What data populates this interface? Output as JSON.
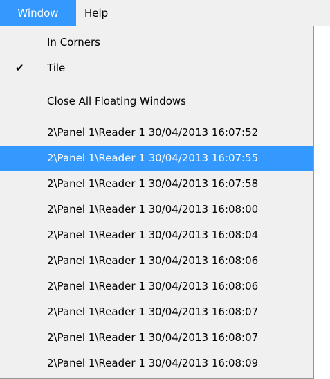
{
  "menubar": {
    "window_label": "Window",
    "help_label": "Help"
  },
  "menu": {
    "in_corners": "In Corners",
    "tile": "Tile",
    "tile_checked": "✔",
    "close_all": "Close All Floating Windows",
    "windows": [
      "2\\Panel 1\\Reader 1 30/04/2013 16:07:52",
      "2\\Panel 1\\Reader 1 30/04/2013 16:07:55",
      "2\\Panel 1\\Reader 1 30/04/2013 16:07:58",
      "2\\Panel 1\\Reader 1 30/04/2013 16:08:00",
      "2\\Panel 1\\Reader 1 30/04/2013 16:08:04",
      "2\\Panel 1\\Reader 1 30/04/2013 16:08:06",
      "2\\Panel 1\\Reader 1 30/04/2013 16:08:06",
      "2\\Panel 1\\Reader 1 30/04/2013 16:08:07",
      "2\\Panel 1\\Reader 1 30/04/2013 16:08:07",
      "2\\Panel 1\\Reader 1 30/04/2013 16:08:09"
    ]
  },
  "colors": {
    "highlight": "#3399ff",
    "menu_bg": "#f0f0f0"
  }
}
